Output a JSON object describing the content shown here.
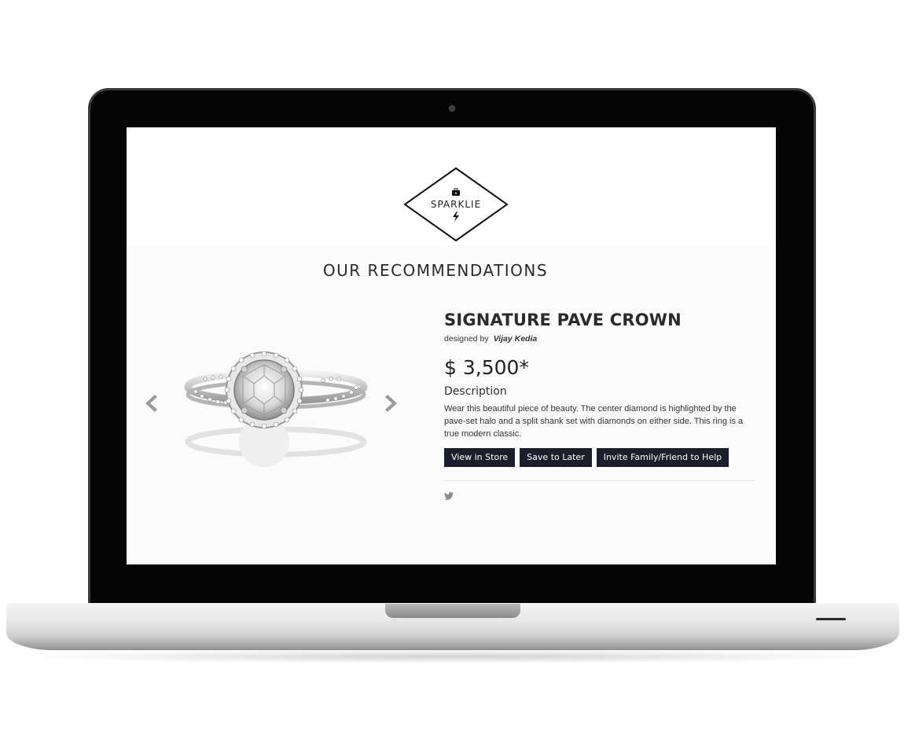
{
  "brand": {
    "name": "SPARKLIE"
  },
  "page": {
    "section_title": "OUR RECOMMENDATIONS"
  },
  "product": {
    "title": "SIGNATURE PAVE CROWN",
    "designed_by_label": "designed by",
    "designer_name": "Vijay Kedia",
    "price": "$ 3,500*",
    "description_label": "Description",
    "description": "Wear this beautiful piece of beauty. The center diamond is highlighted by the pave-set halo and a split shank set with diamonds on either side. This ring is a true modern classic."
  },
  "actions": {
    "view_in_store": "View in Store",
    "save_to_later": "Save to Later",
    "invite_help": "Invite Family/Friend to Help"
  },
  "social": {
    "icons": [
      "twitter-icon"
    ]
  },
  "carousel": {
    "icons": [
      "chevron-left-icon",
      "chevron-right-icon"
    ]
  },
  "colors": {
    "button_bg": "#1c1f2b",
    "button_text": "#ffffff",
    "screen_bg": "#ffffff",
    "bezel": "#050505"
  }
}
